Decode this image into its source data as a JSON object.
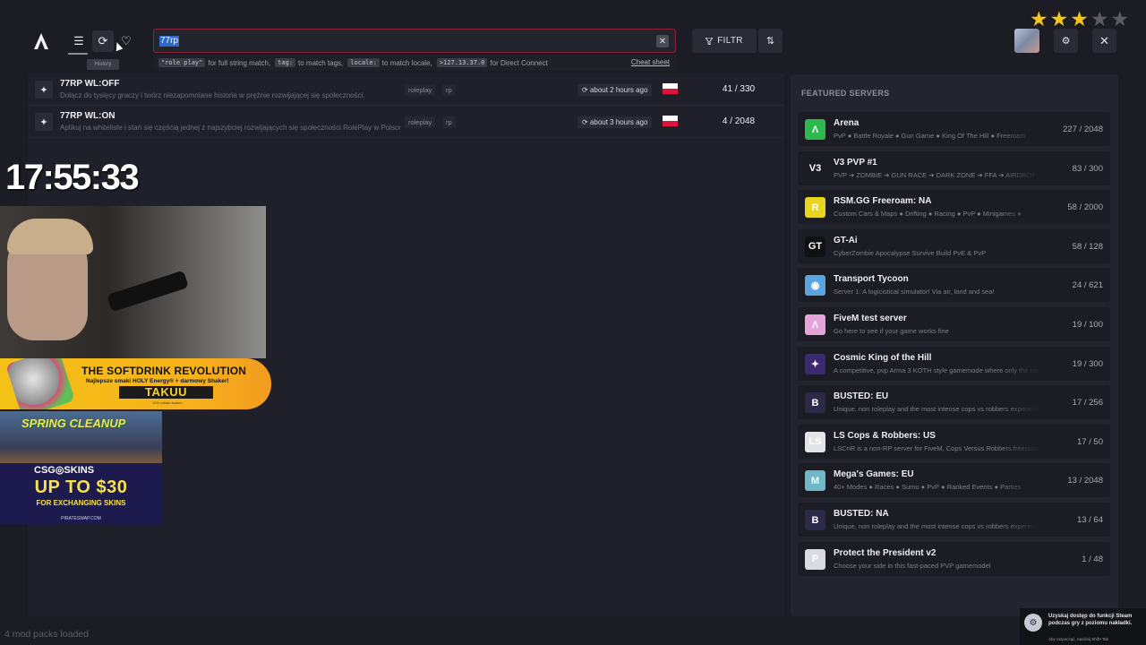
{
  "header": {
    "logo_icon": "altv-logo-icon",
    "menu_icon": "menu-icon",
    "history_icon": "history-icon",
    "favorites_icon": "heart-icon",
    "tooltip": "History"
  },
  "search": {
    "value": "77rp",
    "clear_label": "✕",
    "hints": [
      {
        "code": "\"role play\"",
        "text": "for full string match,"
      },
      {
        "code": "tag:",
        "text": "to match tags,"
      },
      {
        "code": "locale:",
        "text": "to match locale,"
      },
      {
        "code": ">127.13.37.0",
        "text": "for Direct Connect"
      }
    ],
    "cheat_sheet": "Cheat sheet"
  },
  "filter": {
    "icon": "filter-icon",
    "label": "FILTR",
    "sort_icon": "sort-icon"
  },
  "rating": {
    "value": 3,
    "max": 5
  },
  "topright": {
    "settings_icon": "gear-icon",
    "close_icon": "close-icon"
  },
  "servers": [
    {
      "name": "77RP WL:OFF",
      "description": "Dołącz do tysięcy graczy i twórz niezapomniane historie w prężnie rozwijającej się społeczności.",
      "tags": [
        "roleplay",
        "rp"
      ],
      "updated": "about 2 hours ago",
      "locale": "PL",
      "players": "41 / 330"
    },
    {
      "name": "77RP WL:ON",
      "description": "Aplikuj na whiteliste i stań się częścią jednej z najszybciej rozwijających się społeczności RolePlay w Polsce.",
      "tags": [
        "roleplay",
        "rp"
      ],
      "updated": "about 3 hours ago",
      "locale": "PL",
      "players": "4 / 2048"
    }
  ],
  "overlay": {
    "clock": "17:55:33",
    "ad_drink": {
      "title": "THE SOFTDRINK REVOLUTION",
      "subtitle": "Najlepsze smaki HOLY Energy® + darmowy Shaker!",
      "brand": "TAKUU",
      "fine": "10% rabatu kodem"
    },
    "ad_skins": {
      "banner": "SPRING CLEANUP",
      "brand": "CSG◎SKINS",
      "offer": "UP TO $30",
      "sub": "FOR EXCHANGING SKINS",
      "url": "PIRATESWAP.COM"
    }
  },
  "footer": {
    "mod_packs": "4 mod packs loaded"
  },
  "featured": {
    "title": "FEATURED SERVERS",
    "items": [
      {
        "name": "Arena",
        "desc": "PvP ● Battle Royale ● Gun Game ● King Of The Hill ● Freeroam",
        "players": "227 / 2048",
        "icon": "arena-logo-icon",
        "color": "#2fb84f",
        "glyph": "Λ"
      },
      {
        "name": "V3 PVP #1",
        "desc": "PVP ➔ ZOMBIE ➔ GUN RACE ➔ DARK ZONE ➔ FFA ➔ AIRDROP",
        "players": "83 / 300",
        "icon": "v3-logo-icon",
        "color": "#1b1c24",
        "glyph": "V3"
      },
      {
        "name": "RSM.GG Freeroam: NA",
        "desc": "Custom Cars & Maps ● Drifting ● Racing ● PvP ● Minigames ●",
        "players": "58 / 2000",
        "icon": "rsm-logo-icon",
        "color": "#e7d51f",
        "glyph": "R"
      },
      {
        "name": "GT-Ai",
        "desc": "CyberZombie Apocalypse Survive Build PvE & PvP",
        "players": "58 / 128",
        "icon": "gtai-logo-icon",
        "color": "#101114",
        "glyph": "GT"
      },
      {
        "name": "Transport Tycoon",
        "desc": "Server 1: A logicistical simulator! Via air, land and sea!",
        "players": "24 / 621",
        "icon": "globe-icon",
        "color": "#5aa5e0",
        "glyph": "◉"
      },
      {
        "name": "FiveM test server",
        "desc": "Go here to see if your game works fine",
        "players": "19 / 100",
        "icon": "fivem-logo-icon",
        "color": "#e7a2d9",
        "glyph": "Λ"
      },
      {
        "name": "Cosmic King of the Hill",
        "desc": "A competitive, pvp Arma 3 KOTH style gamemode where only the best survive",
        "players": "19 / 300",
        "icon": "cosmic-logo-icon",
        "color": "#3b2a72",
        "glyph": "✦"
      },
      {
        "name": "BUSTED: EU",
        "desc": "Unique, non roleplay and the most intense cops vs robbers experience",
        "players": "17 / 256",
        "icon": "busted-logo-icon",
        "color": "#2c2a48",
        "glyph": "B"
      },
      {
        "name": "LS Cops & Robbers: US",
        "desc": "LSCnR is a non-RP server for FiveM, Cops Versus Robbers freeroam",
        "players": "17 / 50",
        "icon": "lscnr-logo-icon",
        "color": "#e4e4e8",
        "glyph": "LS"
      },
      {
        "name": "Mega's Games: EU",
        "desc": "40+ Modes ● Races ● Sumo ● PvP ● Ranked Events ● Parties",
        "players": "13 / 2048",
        "icon": "megas-logo-icon",
        "color": "#6fb8c8",
        "glyph": "M"
      },
      {
        "name": "BUSTED: NA",
        "desc": "Unique, non roleplay and the most intense cops vs robbers experience",
        "players": "13 / 64",
        "icon": "busted-logo-icon",
        "color": "#2c2a48",
        "glyph": "B"
      },
      {
        "name": "Protect the President v2",
        "desc": "Choose your side in this fast-paced PVP gamemodel",
        "players": "1 / 48",
        "icon": "ptp-logo-icon",
        "color": "#d9dbe0",
        "glyph": "P"
      }
    ]
  },
  "steam": {
    "icon": "steam-icon",
    "message": "Uzyskaj dostęp do funkcji Steam podczas gry z poziomu nakładki.",
    "hint": "Aby rozpocząć, naciśnij Shift+Tab"
  }
}
